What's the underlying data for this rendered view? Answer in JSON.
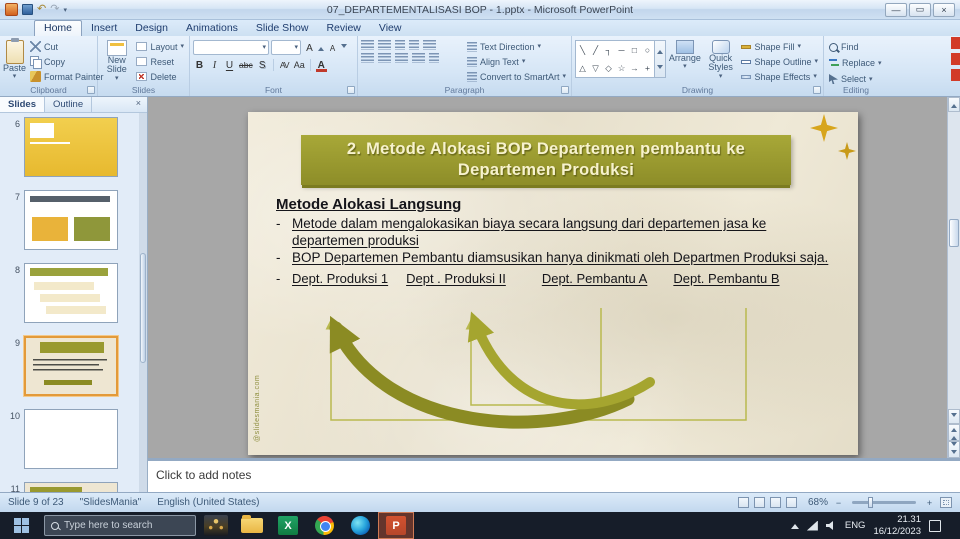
{
  "titlebar": {
    "title": "07_DEPARTEMENTALISASI BOP - 1.pptx  -  Microsoft PowerPoint"
  },
  "icons": {
    "undo": "↶",
    "redo": "↷",
    "minimize": "—",
    "maximize": "▭",
    "close": "×",
    "caret": "▾",
    "panel_close": "×",
    "excel_glyph": "X",
    "powerpoint_glyph": "P"
  },
  "ribbon": {
    "tabs": [
      {
        "label": "Home"
      },
      {
        "label": "Insert"
      },
      {
        "label": "Design"
      },
      {
        "label": "Animations"
      },
      {
        "label": "Slide Show"
      },
      {
        "label": "Review"
      },
      {
        "label": "View"
      }
    ],
    "clipboard": {
      "label": "Clipboard",
      "paste": "Paste",
      "cut": "Cut",
      "copy": "Copy",
      "format_painter": "Format Painter"
    },
    "slides": {
      "label": "Slides",
      "new_slide": "New Slide",
      "layout": "Layout",
      "reset": "Reset",
      "delete": "Delete"
    },
    "font": {
      "label": "Font",
      "bold": "B",
      "italic": "I",
      "underline": "U",
      "strikethrough": "abc",
      "shadow": "S",
      "char_spacing": "AV",
      "change_case": "Aa",
      "grow": "A",
      "shrink": "A",
      "color": "A"
    },
    "paragraph": {
      "label": "Paragraph",
      "text_direction": "Text Direction",
      "align_text": "Align Text",
      "smartart": "Convert to SmartArt"
    },
    "drawing": {
      "label": "Drawing",
      "arrange": "Arrange",
      "quick_styles": "Quick Styles",
      "shape_fill": "Shape Fill",
      "shape_outline": "Shape Outline",
      "shape_effects": "Shape Effects",
      "shapes": [
        "╲",
        "╱",
        "┐",
        "─",
        "□",
        "○",
        "△",
        "▽",
        "◇",
        "☆",
        "→",
        "+"
      ]
    },
    "editing": {
      "label": "Editing",
      "find": "Find",
      "replace": "Replace",
      "select": "Select"
    }
  },
  "slides_panel": {
    "tabs": [
      {
        "label": "Slides"
      },
      {
        "label": "Outline"
      }
    ],
    "thumbnails": [
      {
        "number": "6"
      },
      {
        "number": "7"
      },
      {
        "number": "8"
      },
      {
        "number": "9"
      },
      {
        "number": "10"
      },
      {
        "number": "11"
      }
    ]
  },
  "slide": {
    "title": "2. Metode Alokasi BOP Departemen pembantu ke Departemen Produksi",
    "heading": "Metode Alokasi Langsung",
    "dash": "-",
    "bullets": [
      {
        "text": "Metode dalam mengalokasikan biaya secara langsung dari departemen jasa ke departemen produksi"
      },
      {
        "text": "BOP Departemen Pembantu diamsusikan hanya dinikmati oleh Departmen Produksi saja."
      }
    ],
    "departments": [
      {
        "name": "Dept. Produksi 1"
      },
      {
        "name": "Dept . Produksi II"
      },
      {
        "name": "Dept. Pembantu A"
      },
      {
        "name": "Dept. Pembantu B"
      }
    ],
    "watermark": "@slidesmania.com"
  },
  "notes": {
    "placeholder": "Click to add notes"
  },
  "statusbar": {
    "slide_info": "Slide 9 of 23",
    "theme": "\"SlidesMania\"",
    "language": "English (United States)",
    "zoom": "68%"
  },
  "taskbar": {
    "search_placeholder": "Type here to search",
    "language": "ENG",
    "time": "21.31",
    "date": "16/12/2023"
  }
}
